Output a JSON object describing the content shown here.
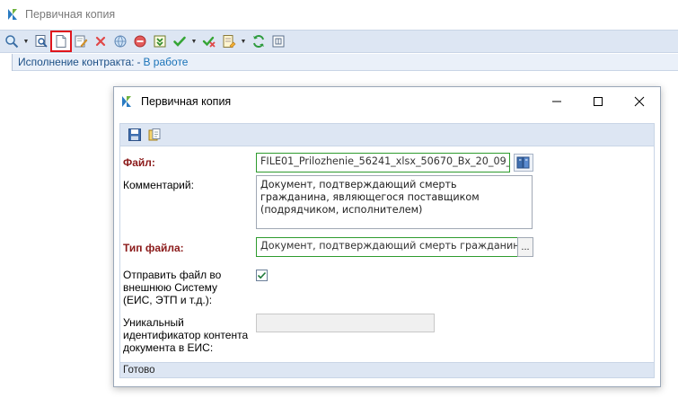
{
  "app": {
    "title": "Первичная копия"
  },
  "toolbar": {
    "icons": [
      "search-icon",
      "preview-icon",
      "new-document-icon",
      "edit-icon",
      "delete-icon",
      "globe-icon",
      "stop-icon",
      "export-icon",
      "approve-icon",
      "reject-icon",
      "document-menu-icon",
      "refresh-icon",
      "grid-icon"
    ],
    "highlight_color": "#e0151b"
  },
  "breadcrumb": {
    "label": "Исполнение контракта:",
    "separator": "-",
    "status": "В работе"
  },
  "dialog": {
    "title": "Первичная копия",
    "toolbar_icons": [
      "save-icon",
      "attach-icon"
    ],
    "file": {
      "label": "Файл:",
      "value": "FILE01_Prilozhenie_56241_xlsx_50670_Bx_20_09_"
    },
    "comment": {
      "label": "Комментарий:",
      "value": "Документ, подтверждающий смерть гражданина, являющегося поставщиком (подрядчиком, исполнителем)"
    },
    "file_type": {
      "label": "Тип файла:",
      "value": "Документ, подтверждающий смерть гражданина, я",
      "button": "..."
    },
    "send_external": {
      "label_lines": [
        "Отправить файл во",
        "внешнюю Систему",
        "(ЕИС, ЭТП и т.д.):"
      ],
      "checked": true
    },
    "uid": {
      "label_lines": [
        "Уникальный",
        "идентификатор контента",
        "документа в ЕИС:"
      ],
      "value": ""
    },
    "status": "Готово"
  },
  "colors": {
    "accent_blue": "#1c4f86",
    "required_label": "#8b1a1a",
    "valid_border": "#2e9b2e",
    "toolbar_bg": "#dde6f3"
  }
}
